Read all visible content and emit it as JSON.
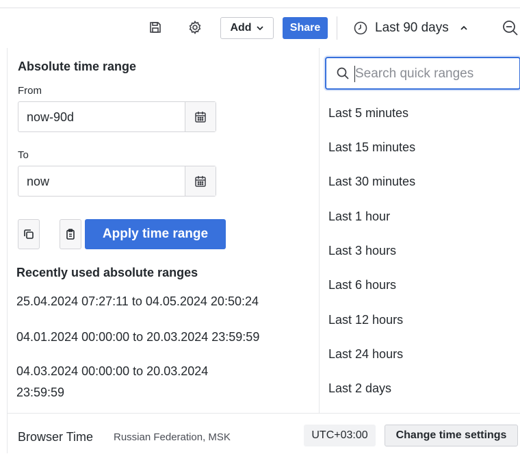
{
  "toolbar": {
    "save_icon": "save-icon",
    "settings_icon": "gear-icon",
    "add_label": "Add",
    "share_label": "Share",
    "time_range_label": "Last 90 days",
    "zoom_icon": "zoom-out-icon",
    "accent": "#3871dc"
  },
  "absolute": {
    "title": "Absolute time range",
    "from_label": "From",
    "from_value": "now-90d",
    "to_label": "To",
    "to_value": "now",
    "apply_label": "Apply time range",
    "recent_title": "Recently used absolute ranges",
    "recent": [
      "25.04.2024 07:27:11 to 04.05.2024 20:50:24",
      "04.01.2024 00:00:00 to 20.03.2024 23:59:59",
      "04.03.2024 00:00:00 to 20.03.2024",
      "23:59:59"
    ]
  },
  "quick": {
    "search_placeholder": "Search quick ranges",
    "items": [
      "Last 5 minutes",
      "Last 15 minutes",
      "Last 30 minutes",
      "Last 1 hour",
      "Last 3 hours",
      "Last 6 hours",
      "Last 12 hours",
      "Last 24 hours",
      "Last 2 days"
    ]
  },
  "footer": {
    "browser_time": "Browser Time",
    "location": "Russian Federation, MSK",
    "utc": "UTC+03:00",
    "change_label": "Change time settings"
  }
}
